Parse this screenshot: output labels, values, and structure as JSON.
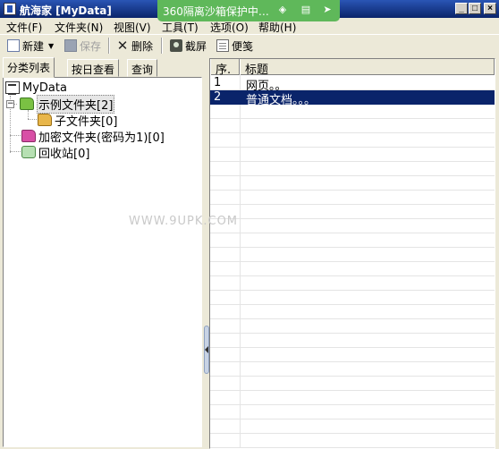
{
  "window": {
    "title": "航海家 [MyData]",
    "controls": {
      "minimize": "_",
      "maximize": "□",
      "close": "×"
    }
  },
  "sandbox_banner": {
    "text": "360隔离沙箱保护中…",
    "color": "#5fb85a",
    "icons": [
      "sandbox-shield-icon",
      "folder-icon",
      "pin-icon"
    ]
  },
  "menu": {
    "items": [
      "文件(F)",
      "文件夹(N)",
      "视图(V)",
      "工具(T)",
      "选项(O)",
      "帮助(H)"
    ]
  },
  "toolbar": {
    "new_label": "新建",
    "save_label": "保存",
    "delete_label": "删除",
    "screenshot_label": "截屏",
    "note_label": "便笺"
  },
  "tabs": [
    "分类列表",
    "按日查看",
    "查询"
  ],
  "tree": {
    "root": "MyData",
    "nodes": [
      "示例文件夹[2]",
      "子文件夹[0]",
      "加密文件夹(密码为1)[0]",
      "回收站[0]"
    ]
  },
  "list": {
    "columns": [
      "序.",
      "标题"
    ],
    "rows": [
      {
        "seq": "1",
        "title": "网页。。"
      },
      {
        "seq": "2",
        "title": "普通文档。。。"
      }
    ],
    "selected_row": 2,
    "selection_color": "#0a246a"
  },
  "watermark": "WWW.9UPK.COM"
}
